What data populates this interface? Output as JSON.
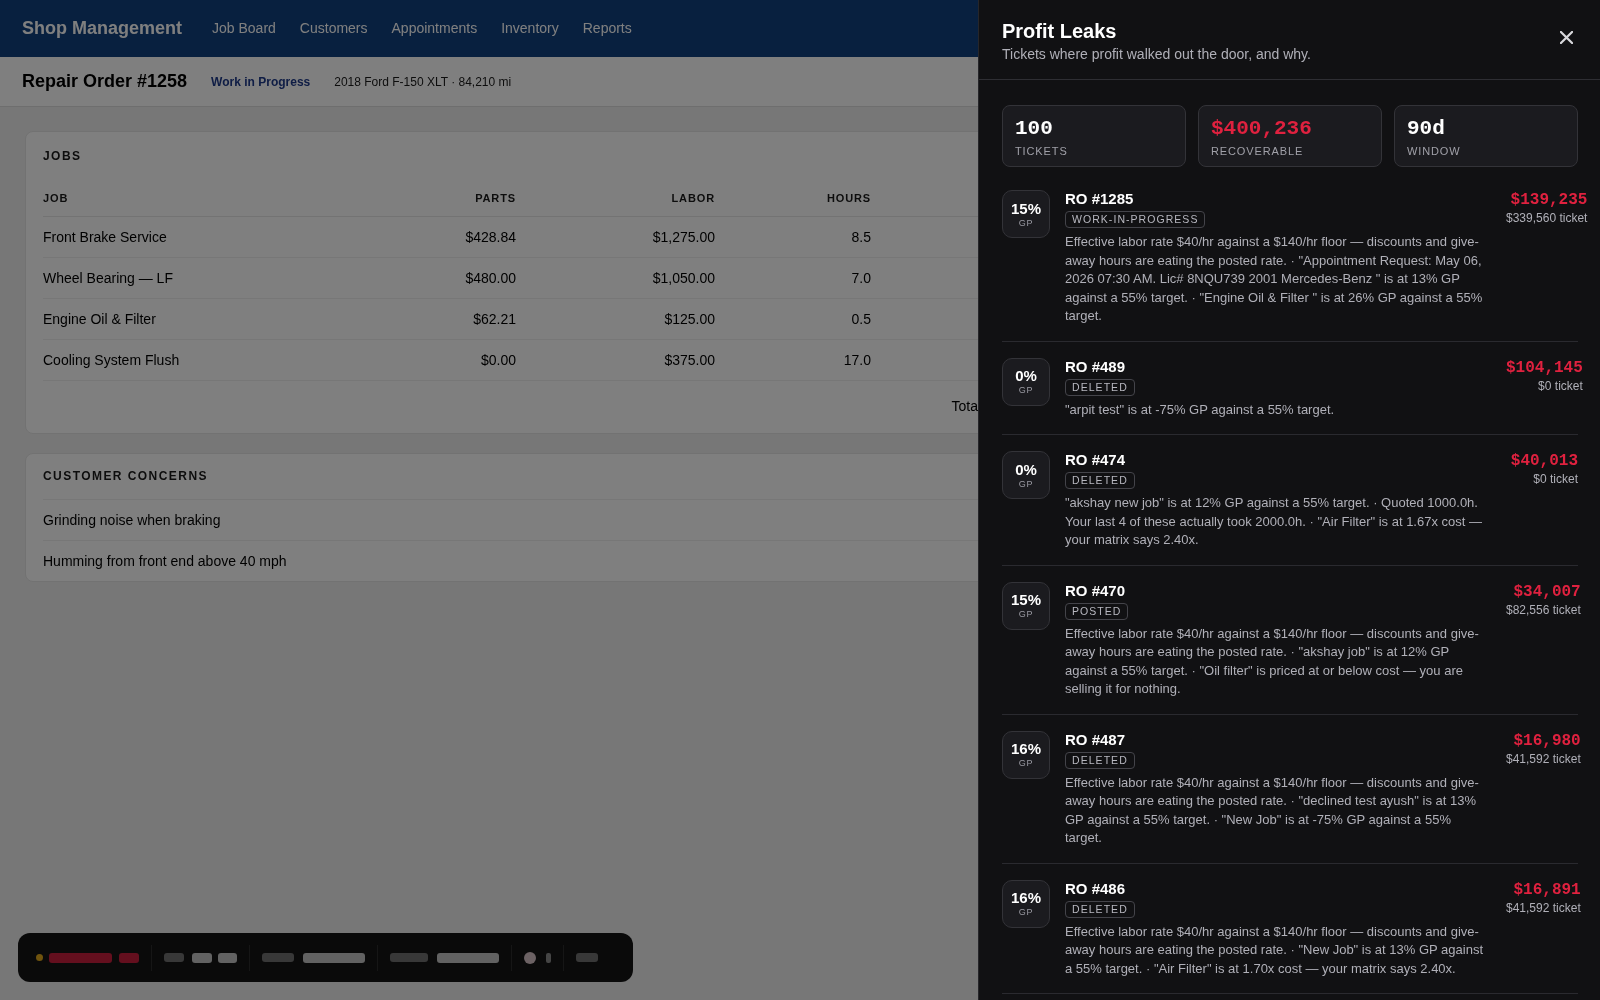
{
  "background_page": {
    "nav": {
      "brand": "Shop Management",
      "links": [
        "Job Board",
        "Customers",
        "Appointments",
        "Inventory",
        "Reports"
      ]
    },
    "header": {
      "title": "Repair Order #1258",
      "status": "Work in Progress",
      "vehicle": "2018 Ford F-150 XLT · 84,210 mi"
    },
    "jobs": {
      "title": "JOBS",
      "columns": [
        "JOB",
        "PARTS",
        "LABOR",
        "HOURS"
      ],
      "rows": [
        [
          "Front Brake Service",
          "$428.84",
          "$1,275.00",
          "8.5"
        ],
        [
          "Wheel Bearing — LF",
          "$480.00",
          "$1,050.00",
          "7.0"
        ],
        [
          "Engine Oil & Filter",
          "$62.21",
          "$125.00",
          "0.5"
        ],
        [
          "Cooling System Flush",
          "$0.00",
          "$375.00",
          "17.0"
        ]
      ],
      "footer": "Tota"
    },
    "concerns": {
      "title": "CUSTOMER CONCERNS",
      "items": [
        "Grinding noise when braking",
        "Humming from front end above 40 mph"
      ]
    }
  },
  "panel": {
    "title": "Profit Leaks",
    "subtitle": "Tickets where profit walked out the door, and why.",
    "stats": [
      {
        "value": "100",
        "label": "TICKETS",
        "kind": "count"
      },
      {
        "value": "$400,236",
        "label": "RECOVERABLE",
        "kind": "money"
      },
      {
        "value": "90d",
        "label": "WINDOW",
        "kind": "period"
      }
    ],
    "tickets": [
      {
        "gp": "15%",
        "gp_label": "GP",
        "ro": "RO #1285",
        "status": "WORK-IN-PROGRESS",
        "description": "Effective labor rate $40/hr against a $140/hr floor — discounts and give-away hours are eating the posted rate. · \"Appointment Request: May 06, 2026 07:30 AM. Lic# 8NQU739 2001 Mercedes-Benz \" is at 13% GP against a 55% target. · \"Engine Oil & Filter \" is at 26% GP against a 55% target.",
        "leak": "$139,235",
        "ticket": "$339,560 ticket"
      },
      {
        "gp": "0%",
        "gp_label": "GP",
        "ro": "RO #489",
        "status": "DELETED",
        "description": "\"arpit test\" is at -75% GP against a 55% target.",
        "leak": "$104,145",
        "ticket": "$0 ticket"
      },
      {
        "gp": "0%",
        "gp_label": "GP",
        "ro": "RO #474",
        "status": "DELETED",
        "description": "\"akshay new job\" is at 12% GP against a 55% target. · Quoted 1000.0h. Your last 4 of these actually took 2000.0h. · \"Air Filter\" is at 1.67x cost — your matrix says 2.40x.",
        "leak": "$40,013",
        "ticket": "$0 ticket"
      },
      {
        "gp": "15%",
        "gp_label": "GP",
        "ro": "RO #470",
        "status": "POSTED",
        "description": "Effective labor rate $40/hr against a $140/hr floor — discounts and give-away hours are eating the posted rate. · \"akshay job\" is at 12% GP against a 55% target. · \"Oil filter\" is priced at or below cost — you are selling it for nothing.",
        "leak": "$34,007",
        "ticket": "$82,556 ticket"
      },
      {
        "gp": "16%",
        "gp_label": "GP",
        "ro": "RO #487",
        "status": "DELETED",
        "description": "Effective labor rate $40/hr against a $140/hr floor — discounts and give-away hours are eating the posted rate. · \"declined test ayush\" is at 13% GP against a 55% target. · \"New Job\" is at -75% GP against a 55% target.",
        "leak": "$16,980",
        "ticket": "$41,592 ticket"
      },
      {
        "gp": "16%",
        "gp_label": "GP",
        "ro": "RO #486",
        "status": "DELETED",
        "description": "Effective labor rate $40/hr against a $140/hr floor — discounts and give-away hours are eating the posted rate. · \"New Job\" is at 13% GP against a 55% target. · \"Air Filter\" is at 1.70x cost — your matrix says 2.40x.",
        "leak": "$16,891",
        "ticket": "$41,592 ticket"
      }
    ]
  }
}
